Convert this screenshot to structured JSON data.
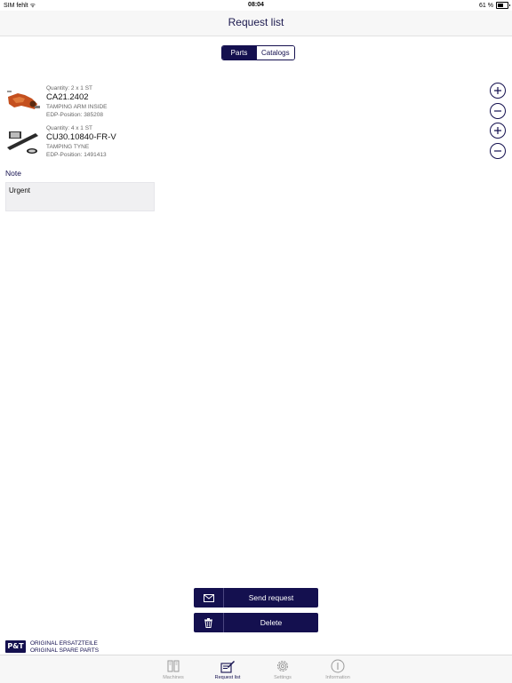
{
  "status_bar": {
    "carrier": "SIM fehlt",
    "time": "08:04",
    "battery": "61 %"
  },
  "nav": {
    "title": "Request list"
  },
  "segmented": {
    "parts": "Parts",
    "catalogs": "Catalogs",
    "selected": "Parts"
  },
  "items": [
    {
      "quantity": "Quantity: 2 x 1 ST",
      "part_number": "CA21.2402",
      "description": "TAMPING ARM INSIDE",
      "edp": "EDP-Position: 385208",
      "thumb_icon": "tamping-arm-image"
    },
    {
      "quantity": "Quantity: 4 x 1 ST",
      "part_number": "CU30.10840-FR-V",
      "description": "TAMPING TYNE",
      "edp": "EDP-Position: 1491413",
      "thumb_icon": "tamping-tyne-image"
    }
  ],
  "note": {
    "label": "Note",
    "value": "Urgent"
  },
  "actions": {
    "send_label": "Send request",
    "delete_label": "Delete"
  },
  "brand": {
    "logo_text": "P&T",
    "line1": "ORIGINAL ERSATZTEILE",
    "line2": "ORIGINAL SPARE PARTS"
  },
  "tabs": [
    {
      "label": "Machines",
      "icon": "book-icon"
    },
    {
      "label": "Request list",
      "icon": "request-list-icon"
    },
    {
      "label": "Settings",
      "icon": "gear-icon"
    },
    {
      "label": "Information",
      "icon": "info-icon"
    }
  ],
  "colors": {
    "primary": "#14104f",
    "nav_background": "#f7f7f7",
    "note_background": "#f0f0f2"
  }
}
